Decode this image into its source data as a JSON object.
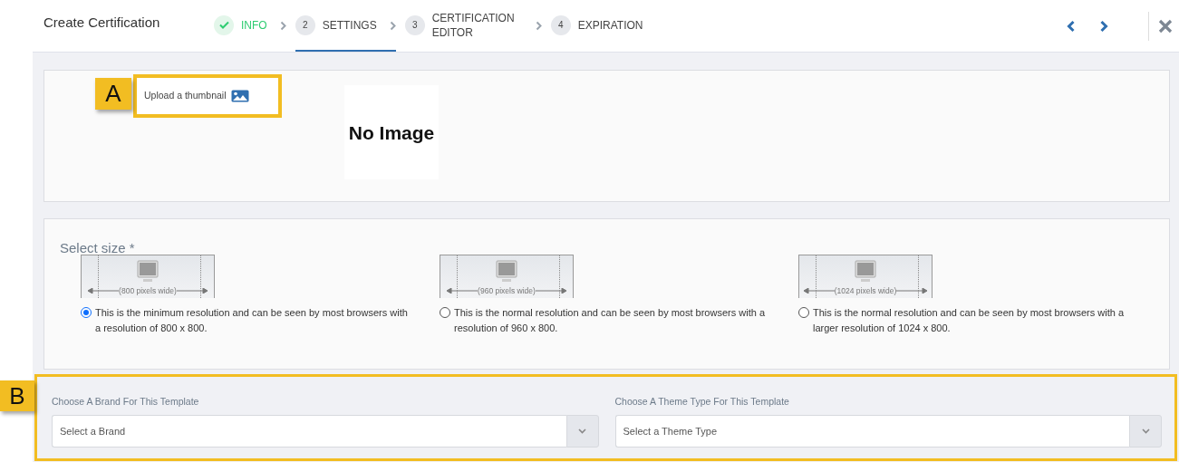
{
  "header": {
    "title": "Create Certification"
  },
  "steps": [
    {
      "label": "INFO",
      "completed": true,
      "selected": false
    },
    {
      "number": "2",
      "label": "SETTINGS",
      "completed": false,
      "selected": true
    },
    {
      "number": "3",
      "label": "CERTIFICATION EDITOR",
      "completed": false,
      "selected": false
    },
    {
      "number": "4",
      "label": "EXPIRATION",
      "completed": false,
      "selected": false
    }
  ],
  "thumbnail": {
    "upload_label": "Upload a thumbnail",
    "preview_text": "No Image"
  },
  "size": {
    "label": "Select size *",
    "options": [
      {
        "caption": "(800 pixels wide)",
        "description": "This is the minimum resolution and can be seen by most browsers with a resolution of 800 x 800.",
        "selected": true
      },
      {
        "caption": "(960 pixels wide)",
        "description": "This is the normal resolution and can be seen by most browsers with a resolution of 960 x 800.",
        "selected": false
      },
      {
        "caption": "(1024 pixels wide)",
        "description": "This is the normal resolution and can be seen by most browsers with a larger resolution of 1024 x 800.",
        "selected": false
      }
    ]
  },
  "template": {
    "fields": [
      {
        "label": "Choose A Brand For This Template",
        "placeholder": "Select a Brand"
      },
      {
        "label": "Choose A Theme Type For This Template",
        "placeholder": "Select a Theme Type"
      }
    ]
  },
  "callouts": [
    {
      "label": "A"
    },
    {
      "label": "B"
    }
  ]
}
